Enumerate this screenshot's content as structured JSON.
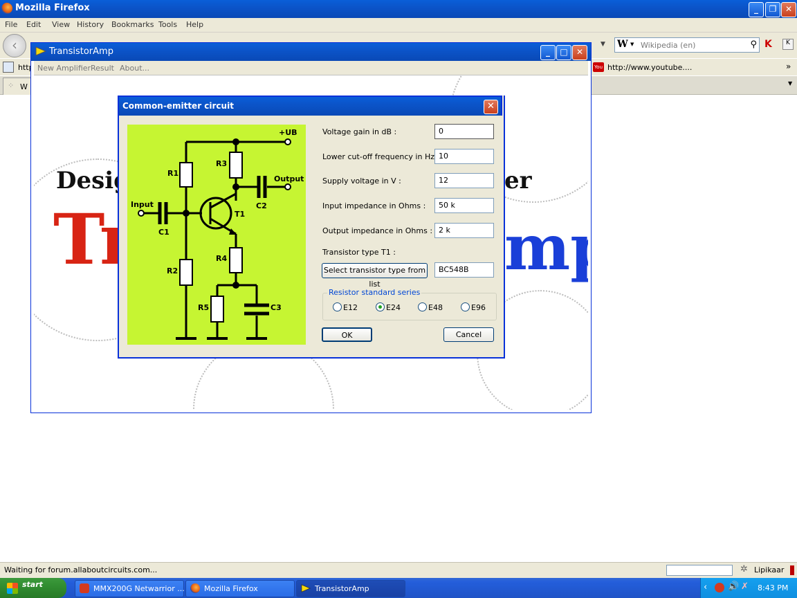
{
  "firefox": {
    "title": "Mozilla Firefox",
    "menu": [
      "File",
      "Edit",
      "View",
      "History",
      "Bookmarks",
      "Tools",
      "Help"
    ],
    "search_placeholder": "Wikipedia (en)",
    "search_engine_letter": "W",
    "bookmark_left": "http",
    "bookmark_right": "http://www.youtube....",
    "tab_left": "W",
    "status_text": "Waiting for forum.allaboutcircuits.com...",
    "status_lang": "Lipikaar"
  },
  "transistoramp": {
    "title": "TransistorAmp",
    "menu": [
      "New Amplifier",
      "Result",
      "About..."
    ],
    "bg_text_left": "Desig",
    "bg_text_right": "er",
    "bg_big_left": "Tr",
    "bg_big_right": "mp"
  },
  "dialog": {
    "title": "Common-emitter circuit",
    "fields": [
      {
        "label": "Voltage gain in dB :",
        "value": "0"
      },
      {
        "label": "Lower cut-off frequency in Hz :",
        "value": "10"
      },
      {
        "label": "Supply voltage in V :",
        "value": "12"
      },
      {
        "label": "Input impedance in Ohms :",
        "value": "50 k"
      },
      {
        "label": "Output impedance in Ohms :",
        "value": "2 k"
      }
    ],
    "transistor_label": "Transistor type T1 :",
    "select_button": "Select transistor type from list",
    "transistor_value": "BC548B",
    "resistor_group_label": "Resistor standard series",
    "resistor_series": [
      "E12",
      "E24",
      "E48",
      "E96"
    ],
    "resistor_selected": "E24",
    "ok_label": "OK",
    "cancel_label": "Cancel",
    "circuit_labels": {
      "ub": "+UB",
      "r1": "R1",
      "r2": "R2",
      "r3": "R3",
      "r4": "R4",
      "r5": "R5",
      "c1": "C1",
      "c2": "C2",
      "c3": "C3",
      "t1": "T1",
      "input": "Input",
      "output": "Output"
    }
  },
  "taskbar": {
    "start_label": "start",
    "tasks": [
      "MMX200G Netwarrior ...",
      "Mozilla Firefox",
      "TransistorAmp"
    ],
    "clock": "8:43 PM"
  }
}
